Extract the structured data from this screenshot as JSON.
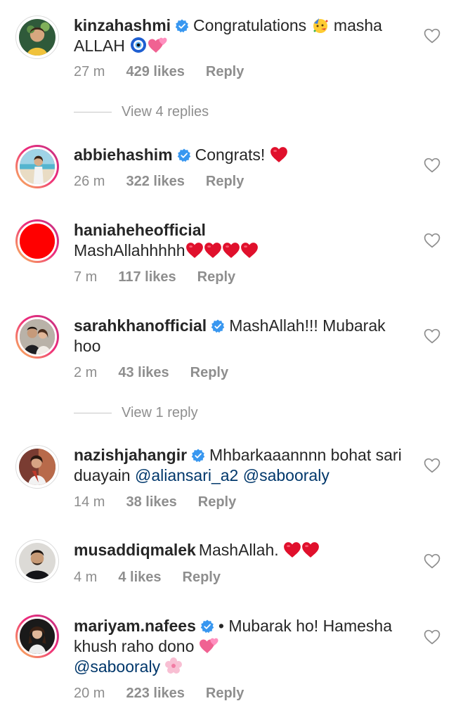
{
  "comments": [
    {
      "username": "kinzahashmi",
      "verified": true,
      "text": "Congratulations",
      "text2": " masha ALLAH",
      "time": "27 m",
      "likes": "429 likes",
      "reply": "Reply"
    },
    {
      "username": "abbiehashim",
      "verified": true,
      "text": "Congrats!",
      "time": "26 m",
      "likes": "322 likes",
      "reply": "Reply"
    },
    {
      "username": "haniaheheofficial",
      "verified": false,
      "text": "MashAllahhhhh",
      "time": "7 m",
      "likes": "117 likes",
      "reply": "Reply"
    },
    {
      "username": "sarahkhanofficial",
      "verified": true,
      "text": "MashAllah!!! Mubarak hoo",
      "time": "2 m",
      "likes": "43 likes",
      "reply": "Reply"
    },
    {
      "username": "nazishjahangir",
      "verified": true,
      "text": "Mhbarkaaannnn bohat sari duayain",
      "mention1": "@aliansari_a2",
      "mention2": "@sabooraly",
      "time": "14 m",
      "likes": "38 likes",
      "reply": "Reply"
    },
    {
      "username": "musaddiqmalek",
      "verified": false,
      "text": "MashAllah.",
      "time": "4 m",
      "likes": "4 likes",
      "reply": "Reply"
    },
    {
      "username": "mariyam.nafees",
      "verified": true,
      "text": "• Mubarak ho! Hamesha khush raho dono",
      "mention1": "@sabooraly",
      "time": "20 m",
      "likes": "223 likes",
      "reply": "Reply"
    }
  ],
  "view_replies": [
    "View 4 replies",
    "View 1 reply"
  ],
  "colors": {
    "verified": "#3897f0",
    "heart": "#e0102c",
    "mention": "#00376b",
    "meta": "#8e8e8e"
  },
  "icons": {
    "like": "heart-outline-icon",
    "verified": "verified-badge-icon"
  }
}
